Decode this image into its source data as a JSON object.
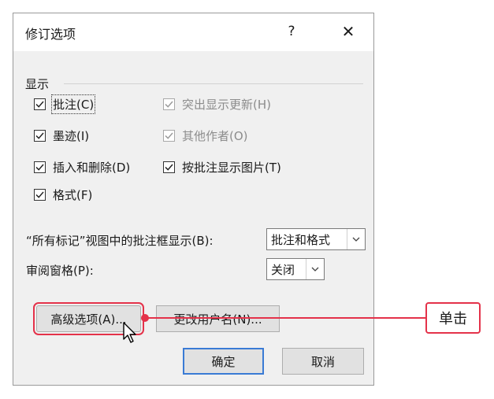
{
  "dialog": {
    "title": "修订选项",
    "help_label": "?",
    "close_label": "✕"
  },
  "display_section": {
    "label": "显示",
    "checkboxes": [
      {
        "label": "批注(C)",
        "checked": true,
        "enabled": true
      },
      {
        "label": "墨迹(I)",
        "checked": true,
        "enabled": true
      },
      {
        "label": "插入和删除(D)",
        "checked": true,
        "enabled": true
      },
      {
        "label": "格式(F)",
        "checked": true,
        "enabled": true
      },
      {
        "label": "突出显示更新(H)",
        "checked": true,
        "enabled": false
      },
      {
        "label": "其他作者(O)",
        "checked": true,
        "enabled": false
      },
      {
        "label": "按批注显示图片(T)",
        "checked": true,
        "enabled": true
      }
    ]
  },
  "balloons": {
    "label": "“所有标记”视图中的批注框显示(B):",
    "value": "批注和格式"
  },
  "review_pane": {
    "label": "审阅窗格(P):",
    "value": "关闭"
  },
  "buttons": {
    "advanced": "高级选项(A)...",
    "change_user": "更改用户名(N)...",
    "ok": "确定",
    "cancel": "取消"
  },
  "annotation": {
    "label": "单击",
    "color": "#e4324a"
  }
}
